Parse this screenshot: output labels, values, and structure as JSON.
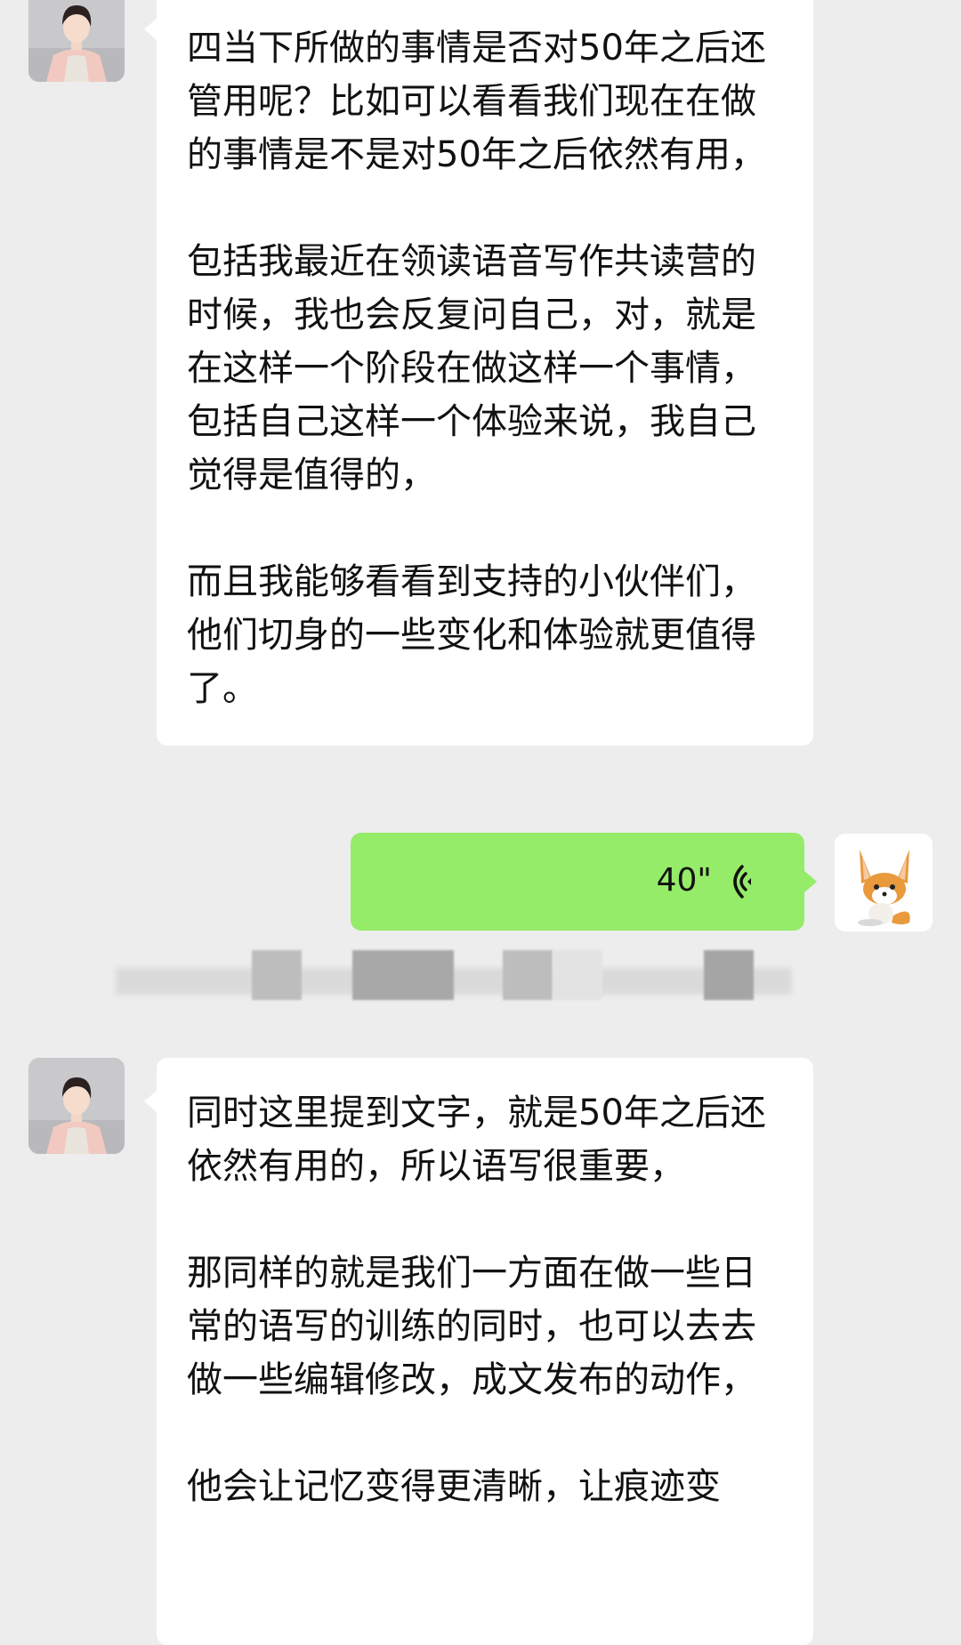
{
  "messages": [
    {
      "sender": "other",
      "paragraphs": [
        "四当下所做的事情是否对50年之后还管用呢？比如可以看看我们现在在做的事情是不是对50年之后依然有用，",
        "包括我最近在领读语音写作共读营的时候，我也会反复问自己，对，就是在这样一个阶段在做这样一个事情，包括自己这样一个体验来说，我自己觉得是值得的，",
        "而且我能够看看到支持的小伙伴们，他们切身的一些变化和体验就更值得了。"
      ]
    },
    {
      "sender": "self",
      "type": "voice",
      "duration": "40\""
    },
    {
      "sender": "other",
      "paragraphs": [
        "同时这里提到文字，就是50年之后还依然有用的，所以语写很重要，",
        "那同样的就是我们一方面在做一些日常的语写的训练的同时，也可以去去做一些编辑修改，成文发布的动作，",
        "他会让记忆变得更清晰，让痕迹变"
      ]
    }
  ],
  "colors": {
    "background": "#ededed",
    "incoming_bubble": "#ffffff",
    "outgoing_bubble": "#95ec69"
  },
  "icons": {
    "voice": "voice-wave-icon",
    "self_avatar": "fox-avatar"
  }
}
